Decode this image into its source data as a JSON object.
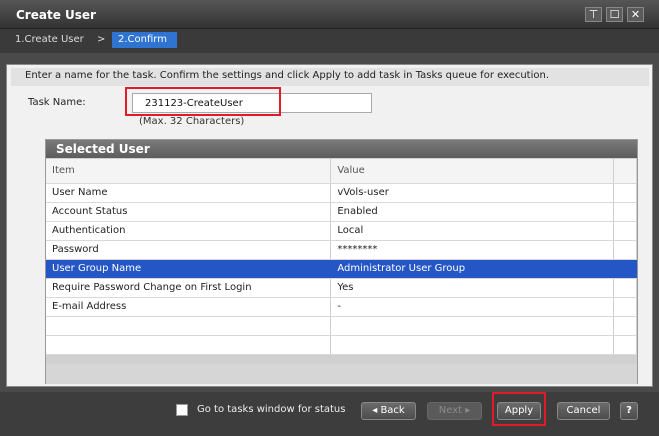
{
  "window": {
    "title": "Create User"
  },
  "steps": {
    "step1": "1.Create User",
    "separator": ">",
    "step2": "2.Confirm"
  },
  "instructions": "Enter a name for the task. Confirm the settings and click Apply to add task in Tasks queue for execution.",
  "task": {
    "label": "Task Name:",
    "value": "231123-CreateUser",
    "hint": "(Max. 32 Characters)"
  },
  "panel": {
    "title": "Selected User",
    "columns": [
      "Item",
      "Value"
    ],
    "rows": [
      {
        "item": "User Name",
        "value": "vVols-user"
      },
      {
        "item": "Account Status",
        "value": "Enabled"
      },
      {
        "item": "Authentication",
        "value": "Local"
      },
      {
        "item": "Password",
        "value": "********"
      },
      {
        "item": "User Group Name",
        "value": "Administrator User Group"
      },
      {
        "item": "Require Password Change on First Login",
        "value": "Yes"
      },
      {
        "item": "E-mail Address",
        "value": "-"
      }
    ]
  },
  "footer": {
    "checkbox_label": "Go to tasks window for status",
    "back": "◂ Back",
    "next": "Next ▸",
    "apply": "Apply",
    "cancel": "Cancel",
    "help": "?"
  },
  "icons": {
    "pin": "pin-icon",
    "maximize": "maximize-icon",
    "close": "close-icon"
  },
  "colors": {
    "selected_row": "#2457c5",
    "active_step": "#2f74d0",
    "highlight": "#e21b2a"
  }
}
